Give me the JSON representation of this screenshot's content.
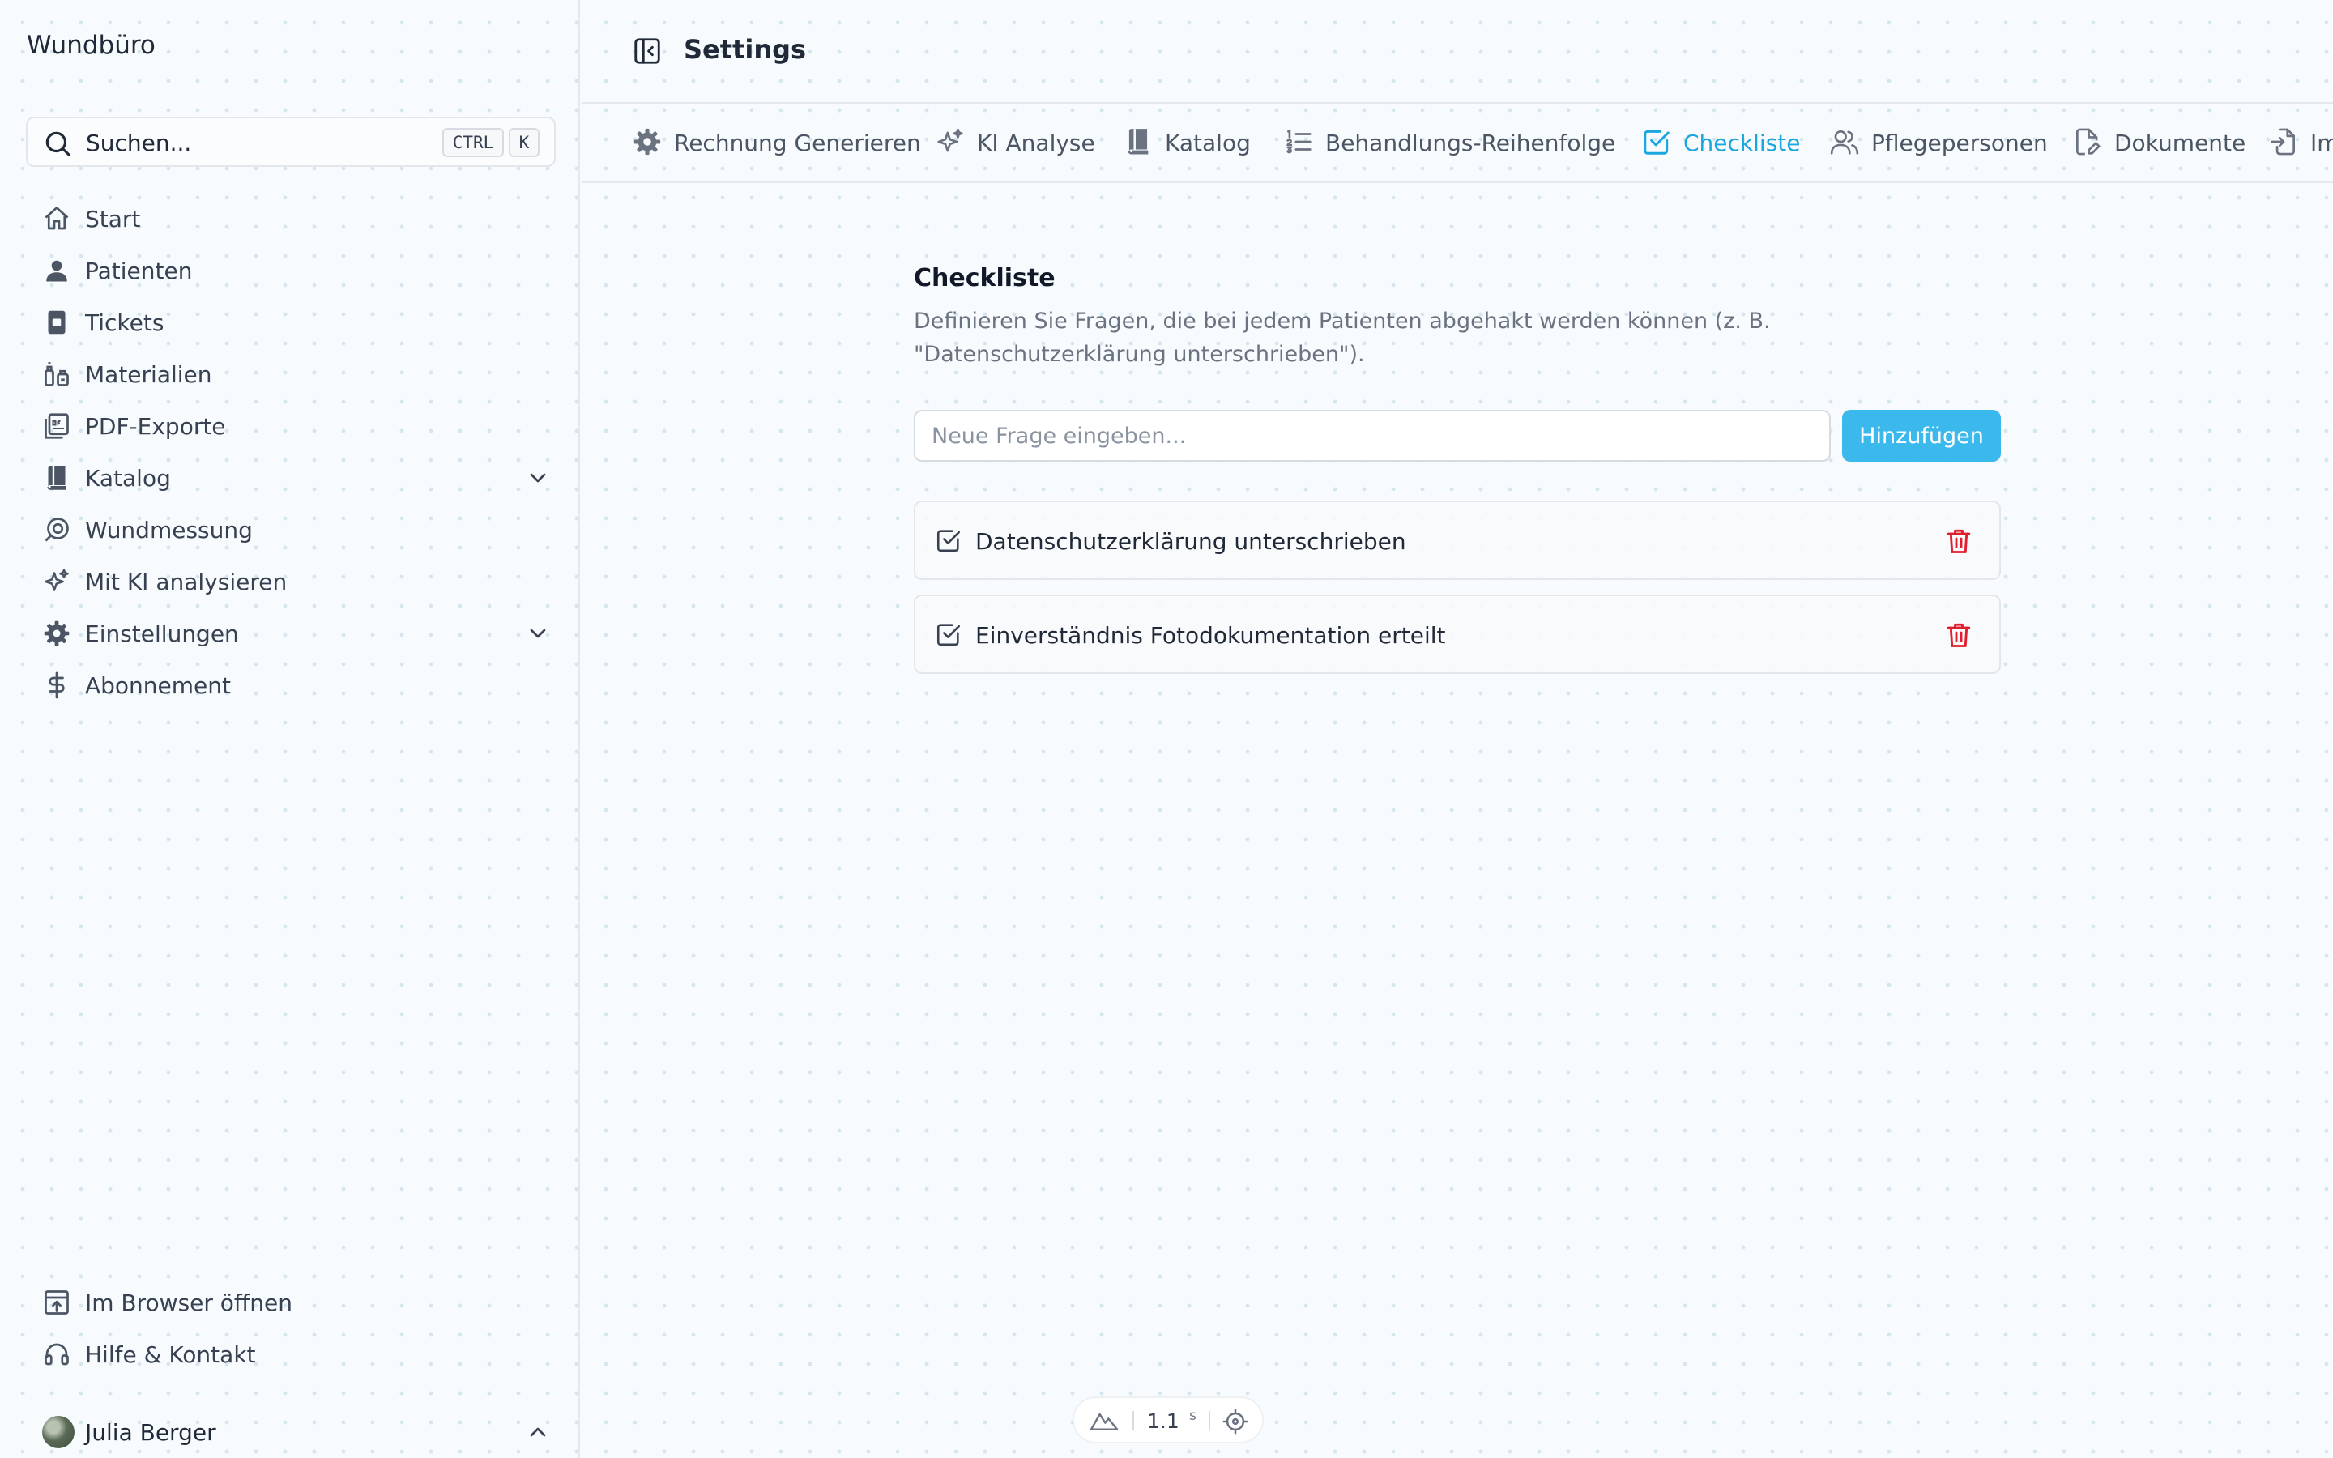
{
  "app": {
    "brand": "Wundbüro"
  },
  "search": {
    "label": "Suchen...",
    "shortcut_ctrl": "CTRL",
    "shortcut_key": "K"
  },
  "sidebar": {
    "items": [
      {
        "label": "Start",
        "icon": "home-icon"
      },
      {
        "label": "Patienten",
        "icon": "user-icon"
      },
      {
        "label": "Tickets",
        "icon": "ticket-icon"
      },
      {
        "label": "Materialien",
        "icon": "materials-icon"
      },
      {
        "label": "PDF-Exporte",
        "icon": "pdf-icon"
      },
      {
        "label": "Katalog",
        "icon": "book-icon",
        "expandable": true
      },
      {
        "label": "Wundmessung",
        "icon": "measure-icon"
      },
      {
        "label": "Mit KI analysieren",
        "icon": "sparkles-icon"
      },
      {
        "label": "Einstellungen",
        "icon": "gear-icon",
        "expandable": true
      },
      {
        "label": "Abonnement",
        "icon": "dollar-icon"
      }
    ],
    "bottom_items": [
      {
        "label": "Im Browser öffnen",
        "icon": "open-browser-icon"
      },
      {
        "label": "Hilfe & Kontakt",
        "icon": "headset-icon"
      }
    ],
    "user": {
      "name": "Julia Berger"
    }
  },
  "header": {
    "title": "Settings"
  },
  "tabs": [
    {
      "label": "Rechnung Generieren",
      "icon": "gear-icon"
    },
    {
      "label": "KI Analyse",
      "icon": "sparkles-icon"
    },
    {
      "label": "Katalog",
      "icon": "book-icon"
    },
    {
      "label": "Behandlungs-Reihenfolge",
      "icon": "list-ordered-icon"
    },
    {
      "label": "Checkliste",
      "icon": "checkbox-icon",
      "active": true
    },
    {
      "label": "Pflegepersonen",
      "icon": "users-icon"
    },
    {
      "label": "Dokumente",
      "icon": "document-edit-icon"
    },
    {
      "label": "Im",
      "icon": "import-icon"
    }
  ],
  "checklist": {
    "title": "Checkliste",
    "description": "Definieren Sie Fragen, die bei jedem Patienten abgehakt werden können (z. B. \"Datenschutzerklärung unterschrieben\").",
    "input_placeholder": "Neue Frage eingeben...",
    "add_label": "Hinzufügen",
    "items": [
      {
        "label": "Datenschutzerklärung unterschrieben"
      },
      {
        "label": "Einverständnis Fotodokumentation erteilt"
      }
    ]
  },
  "status": {
    "value": "1.1",
    "unit": "s"
  },
  "colors": {
    "accent": "#1aa7e0",
    "button": "#3bb9ec",
    "danger": "#e11d2e"
  }
}
